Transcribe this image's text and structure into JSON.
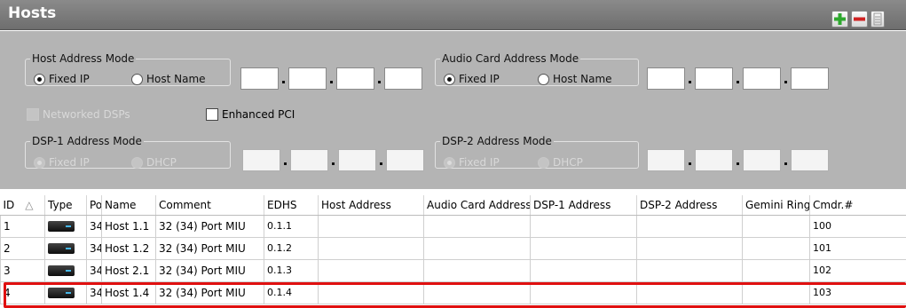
{
  "window": {
    "title": "Hosts"
  },
  "toolbar": {
    "add_icon": "plus-icon",
    "remove_icon": "minus-icon",
    "options_icon": "list-icon",
    "accent_add": "#2ea82e",
    "accent_remove": "#d02020"
  },
  "host_address_mode": {
    "legend": "Host Address Mode",
    "fixed_ip": "Fixed IP",
    "host_name": "Host Name",
    "selected": "fixed_ip"
  },
  "audio_card_address_mode": {
    "legend": "Audio Card Address Mode",
    "fixed_ip": "Fixed IP",
    "host_name": "Host Name",
    "selected": "fixed_ip"
  },
  "options": {
    "networked_dsps": "Networked DSPs",
    "enhanced_pci": "Enhanced PCI"
  },
  "dsp1_address_mode": {
    "legend": "DSP-1 Address Mode",
    "fixed_ip": "Fixed IP",
    "dhcp": "DHCP"
  },
  "dsp2_address_mode": {
    "legend": "DSP-2 Address Mode",
    "fixed_ip": "Fixed IP",
    "dhcp": "DHCP"
  },
  "table": {
    "sort_indicator": "△",
    "columns": [
      "ID",
      "Type",
      "Por",
      "Name",
      "Comment",
      "EDHS",
      "Host Address",
      "Audio Card Address",
      "DSP-1 Address",
      "DSP-2 Address",
      "Gemini Ring",
      "Cmdr.#"
    ],
    "rows": [
      {
        "id": "1",
        "port": "34",
        "name": "Host 1.1",
        "comment": "32 (34) Port MIU",
        "edhs": "0.1.1",
        "host_address": "",
        "audio_card_address": "",
        "dsp1_address": "",
        "dsp2_address": "",
        "gemini_ring": "",
        "cmdr": "100"
      },
      {
        "id": "2",
        "port": "34",
        "name": "Host 1.2",
        "comment": "32 (34) Port MIU",
        "edhs": "0.1.2",
        "host_address": "",
        "audio_card_address": "",
        "dsp1_address": "",
        "dsp2_address": "",
        "gemini_ring": "",
        "cmdr": "101"
      },
      {
        "id": "3",
        "port": "34",
        "name": "Host 2.1",
        "comment": "32 (34) Port MIU",
        "edhs": "0.1.3",
        "host_address": "",
        "audio_card_address": "",
        "dsp1_address": "",
        "dsp2_address": "",
        "gemini_ring": "",
        "cmdr": "102"
      },
      {
        "id": "4",
        "port": "34",
        "name": "Host 1.4",
        "comment": "32 (34) Port MIU",
        "edhs": "0.1.4",
        "host_address": "",
        "audio_card_address": "",
        "dsp1_address": "",
        "dsp2_address": "",
        "gemini_ring": "",
        "cmdr": "103"
      }
    ],
    "highlighted_row_id": "4",
    "highlight_color": "#e01010"
  }
}
